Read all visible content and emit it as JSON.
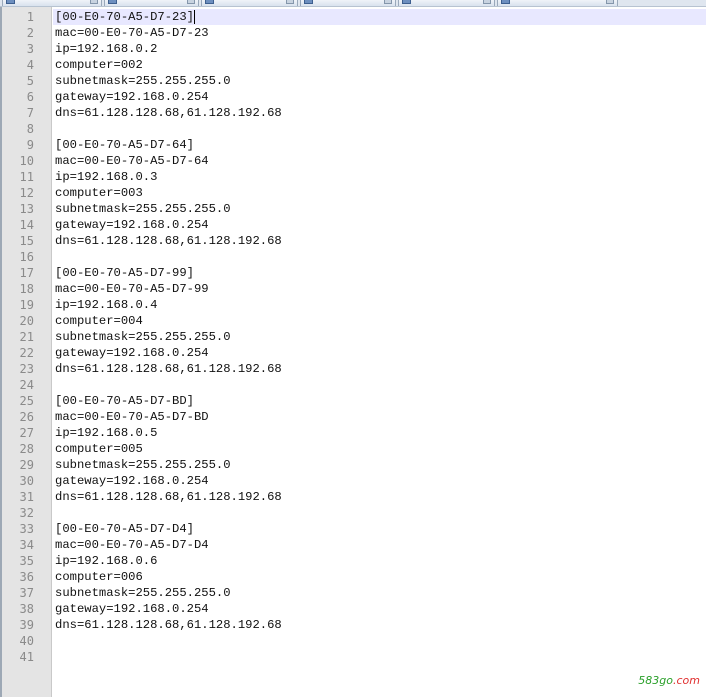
{
  "tabs": [
    {
      "label": "",
      "active": false
    },
    {
      "label": "",
      "active": false
    },
    {
      "label": "",
      "active": false
    },
    {
      "label": "",
      "active": false
    },
    {
      "label": "",
      "active": false
    },
    {
      "label": "",
      "active": false
    }
  ],
  "editor": {
    "current_line": 1,
    "lines": [
      "[00-E0-70-A5-D7-23]",
      "mac=00-E0-70-A5-D7-23",
      "ip=192.168.0.2",
      "computer=002",
      "subnetmask=255.255.255.0",
      "gateway=192.168.0.254",
      "dns=61.128.128.68,61.128.192.68",
      "",
      "[00-E0-70-A5-D7-64]",
      "mac=00-E0-70-A5-D7-64",
      "ip=192.168.0.3",
      "computer=003",
      "subnetmask=255.255.255.0",
      "gateway=192.168.0.254",
      "dns=61.128.128.68,61.128.192.68",
      "",
      "[00-E0-70-A5-D7-99]",
      "mac=00-E0-70-A5-D7-99",
      "ip=192.168.0.4",
      "computer=004",
      "subnetmask=255.255.255.0",
      "gateway=192.168.0.254",
      "dns=61.128.128.68,61.128.192.68",
      "",
      "[00-E0-70-A5-D7-BD]",
      "mac=00-E0-70-A5-D7-BD",
      "ip=192.168.0.5",
      "computer=005",
      "subnetmask=255.255.255.0",
      "gateway=192.168.0.254",
      "dns=61.128.128.68,61.128.192.68",
      "",
      "[00-E0-70-A5-D7-D4]",
      "mac=00-E0-70-A5-D7-D4",
      "ip=192.168.0.6",
      "computer=006",
      "subnetmask=255.255.255.0",
      "gateway=192.168.0.254",
      "dns=61.128.128.68,61.128.192.68",
      "",
      ""
    ]
  },
  "watermark": {
    "prefix": "583go",
    "suffix": ".com"
  },
  "colors": {
    "gutter_bg": "#e4e4e4",
    "line_number": "#8a8a8a",
    "current_line_bg": "#e8e8ff",
    "text": "#111111",
    "watermark_green": "#2aa02a",
    "watermark_red": "#e03030"
  }
}
